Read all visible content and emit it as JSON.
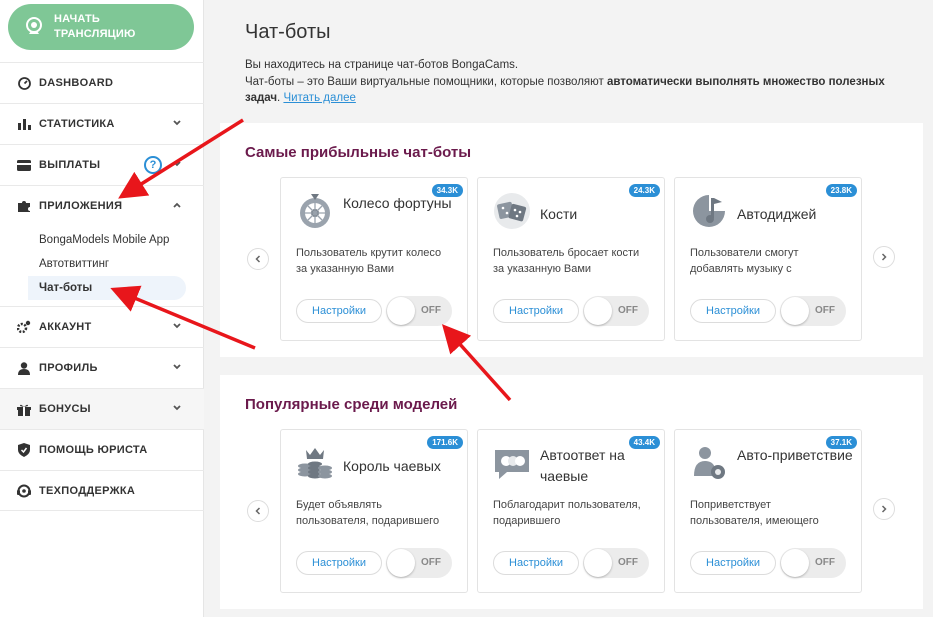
{
  "sidebar": {
    "cta_label": "НАЧАТЬ ТРАНСЛЯЦИЮ",
    "nav": {
      "dashboard": "DASHBOARD",
      "stats": "СТАТИСТИКА",
      "payouts": "ВЫПЛАТЫ",
      "payouts_help": "?",
      "apps": "ПРИЛОЖЕНИЯ",
      "apps_sub": [
        "BongaModels Mobile App",
        "Автотвиттинг",
        "Чат-боты"
      ],
      "account": "АККАУНТ",
      "profile": "ПРОФИЛЬ",
      "bonuses": "БОНУСЫ",
      "lawyer": "ПОМОЩЬ ЮРИСТА",
      "support": "ТЕХПОДДЕРЖКА"
    }
  },
  "main": {
    "title": "Чат-боты",
    "intro_line1": "Вы находитесь на странице чат-ботов BongaCams.",
    "intro_line2_a": "Чат-боты – это Ваши виртуальные помощники, которые позволяют ",
    "intro_line2_b": "автоматически выполнять множество полезных задач",
    "intro_line2_c": ". ",
    "intro_link": "Читать далее"
  },
  "sections": [
    {
      "title": "Самые прибыльные чат-боты",
      "cards": [
        {
          "badge": "34.3K",
          "icon": "wheel-icon",
          "title": "Колесо фортуны",
          "desc": "Пользователь крутит колесо за указанную Вами",
          "settings": "Настройки",
          "toggle": "OFF"
        },
        {
          "badge": "24.3K",
          "icon": "dice-icon",
          "title": "Кости",
          "desc": "Пользователь бросает кости за указанную Вами",
          "settings": "Настройки",
          "toggle": "OFF"
        },
        {
          "badge": "23.8K",
          "icon": "music-icon",
          "title": "Автодиджей",
          "desc": "Пользователи смогут добавлять музыку с",
          "settings": "Настройки",
          "toggle": "OFF"
        }
      ]
    },
    {
      "title": "Популярные среди моделей",
      "cards": [
        {
          "badge": "171.6K",
          "icon": "crown-coins-icon",
          "title": "Король чаевых",
          "desc": "Будет объявлять пользователя, подарившего",
          "settings": "Настройки",
          "toggle": "OFF"
        },
        {
          "badge": "43.4K",
          "icon": "chat-coins-icon",
          "title": "Автоответ на чаевые",
          "desc": "Поблагодарит пользователя, подарившего",
          "settings": "Настройки",
          "toggle": "OFF"
        },
        {
          "badge": "37.1K",
          "icon": "user-greet-icon",
          "title": "Авто-приветствие",
          "desc": "Поприветствует пользователя, имеющего",
          "settings": "Настройки",
          "toggle": "OFF"
        }
      ]
    }
  ],
  "colors": {
    "accent": "#2b8fd6",
    "cta": "#7fc796",
    "section_title": "#6b1a4c",
    "annotation": "#e8161b"
  }
}
